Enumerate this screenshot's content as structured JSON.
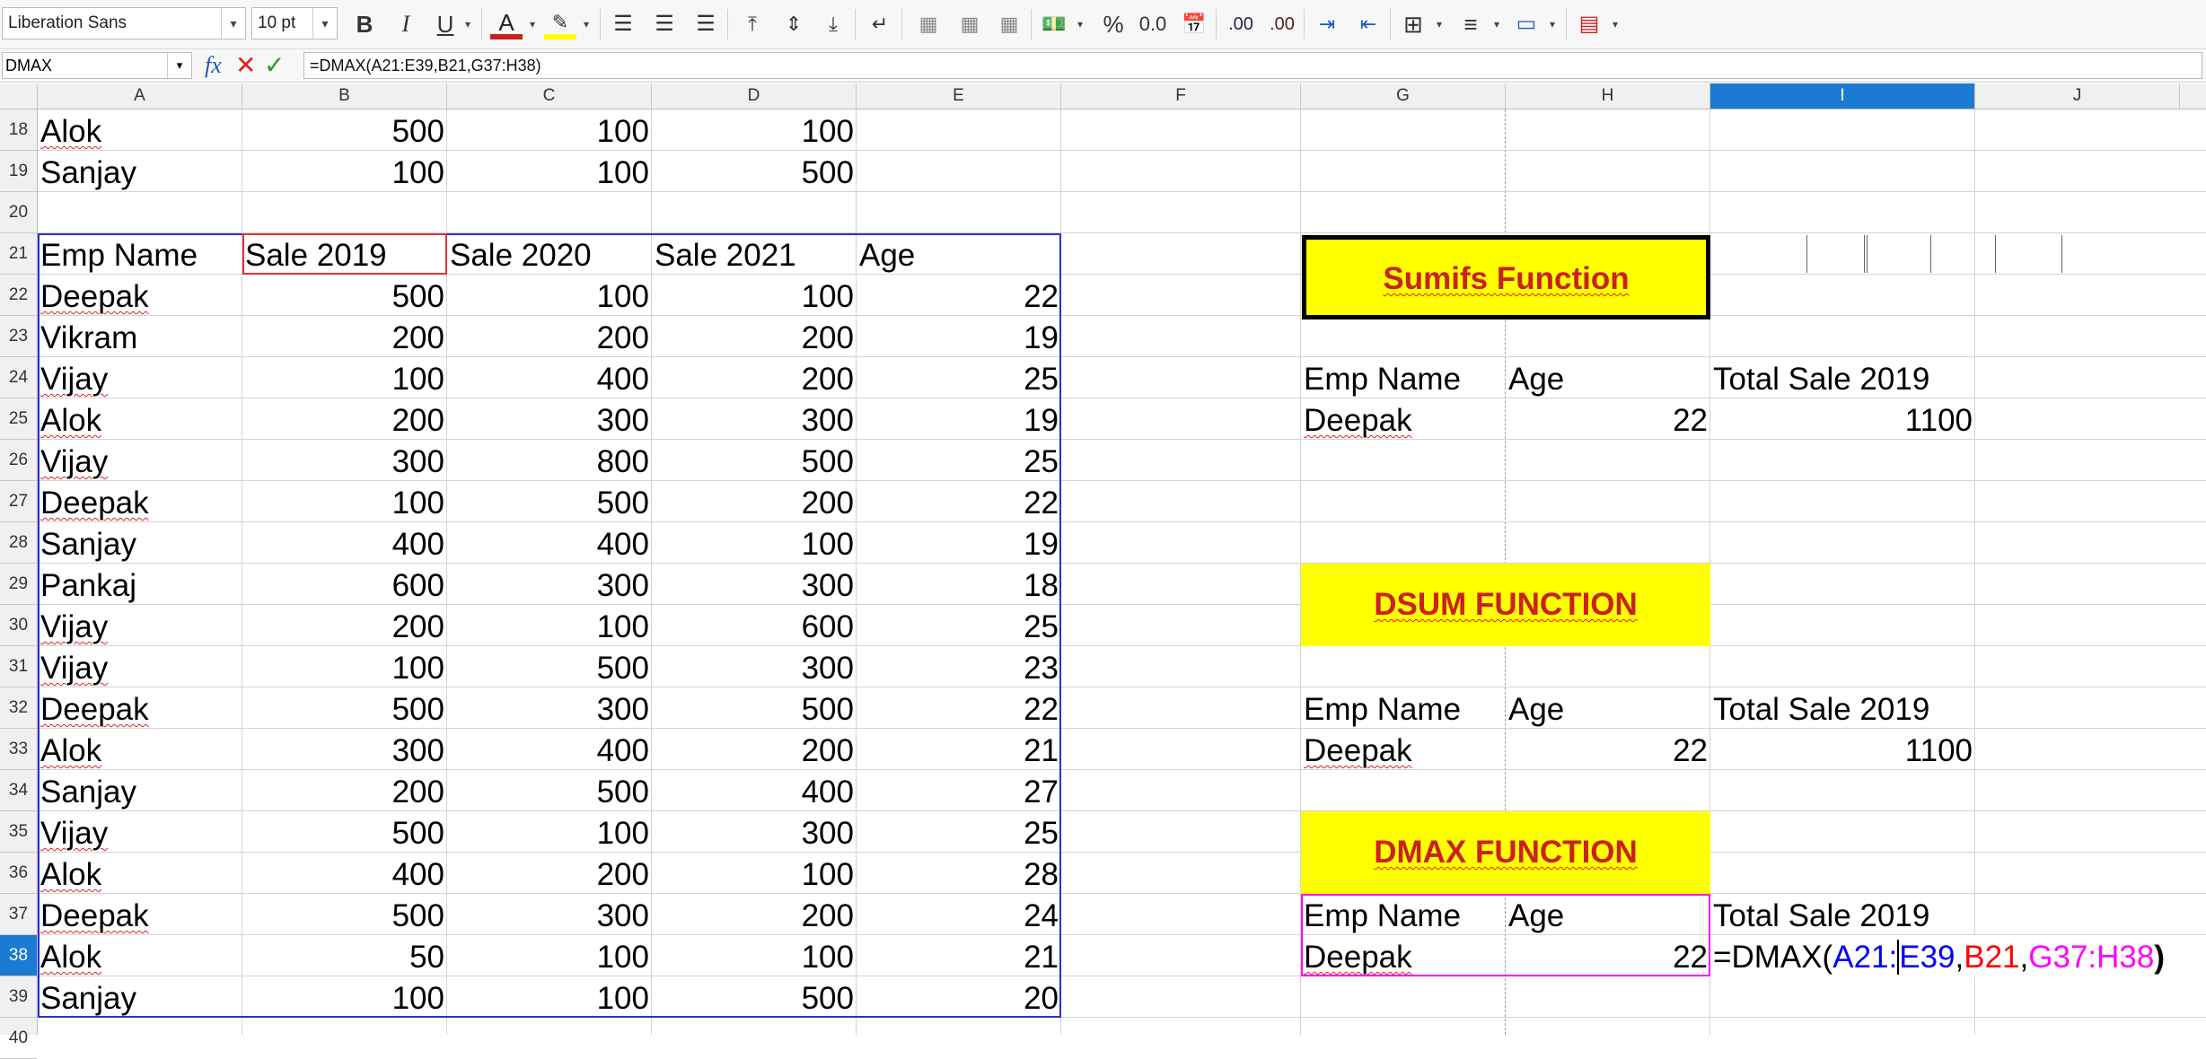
{
  "toolbar": {
    "font_name": "Liberation Sans",
    "font_size": "10 pt",
    "bold": "B",
    "italic": "I",
    "underline": "U",
    "font_color_label": "A",
    "percent": "%",
    "number_format": "0.0",
    "decimal_add": ".00",
    "decimal_remove": ".00"
  },
  "formula_bar": {
    "name_box": "DMAX",
    "fx": "fx",
    "formula": "=DMAX(A21:E39,B21,G37:H38)"
  },
  "columns": [
    "A",
    "B",
    "C",
    "D",
    "E",
    "F",
    "G",
    "H",
    "I",
    "J"
  ],
  "active_column": "I",
  "rows": [
    "18",
    "19",
    "20",
    "21",
    "22",
    "23",
    "24",
    "25",
    "26",
    "27",
    "28",
    "29",
    "30",
    "31",
    "32",
    "33",
    "34",
    "35",
    "36",
    "37",
    "38",
    "39",
    "40"
  ],
  "active_row": "38",
  "main_table": {
    "top_rows": [
      {
        "name": "Alok",
        "b": "500",
        "c": "100",
        "d": "100"
      },
      {
        "name": "Sanjay",
        "b": "100",
        "c": "100",
        "d": "500"
      }
    ],
    "headers": [
      "Emp Name",
      "Sale 2019",
      "Sale 2020",
      "Sale 2021",
      "Age"
    ],
    "rows": [
      {
        "name": "Deepak",
        "b": "500",
        "c": "100",
        "d": "100",
        "e": "22"
      },
      {
        "name": "Vikram",
        "b": "200",
        "c": "200",
        "d": "200",
        "e": "19"
      },
      {
        "name": "Vijay",
        "b": "100",
        "c": "400",
        "d": "200",
        "e": "25"
      },
      {
        "name": "Alok",
        "b": "200",
        "c": "300",
        "d": "300",
        "e": "19"
      },
      {
        "name": "Vijay",
        "b": "300",
        "c": "800",
        "d": "500",
        "e": "25"
      },
      {
        "name": "Deepak",
        "b": "100",
        "c": "500",
        "d": "200",
        "e": "22"
      },
      {
        "name": "Sanjay",
        "b": "400",
        "c": "400",
        "d": "100",
        "e": "19"
      },
      {
        "name": "Pankaj",
        "b": "600",
        "c": "300",
        "d": "300",
        "e": "18"
      },
      {
        "name": "Vijay",
        "b": "200",
        "c": "100",
        "d": "600",
        "e": "25"
      },
      {
        "name": "Vijay",
        "b": "100",
        "c": "500",
        "d": "300",
        "e": "23"
      },
      {
        "name": "Deepak",
        "b": "500",
        "c": "300",
        "d": "500",
        "e": "22"
      },
      {
        "name": "Alok",
        "b": "300",
        "c": "400",
        "d": "200",
        "e": "21"
      },
      {
        "name": "Sanjay",
        "b": "200",
        "c": "500",
        "d": "400",
        "e": "27"
      },
      {
        "name": "Vijay",
        "b": "500",
        "c": "100",
        "d": "300",
        "e": "25"
      },
      {
        "name": "Alok",
        "b": "400",
        "c": "200",
        "d": "100",
        "e": "28"
      },
      {
        "name": "Deepak",
        "b": "500",
        "c": "300",
        "d": "200",
        "e": "24"
      },
      {
        "name": "Alok",
        "b": "50",
        "c": "100",
        "d": "100",
        "e": "21"
      },
      {
        "name": "Sanjay",
        "b": "100",
        "c": "100",
        "d": "500",
        "e": "20"
      }
    ]
  },
  "sumifs": {
    "title": "Sumifs Function",
    "h1": "Emp Name",
    "h2": "Age",
    "h3": "Total Sale 2019",
    "v1": "Deepak",
    "v2": "22",
    "v3": "1100"
  },
  "dsum": {
    "title": "DSUM FUNCTION",
    "h1": "Emp Name",
    "h2": "Age",
    "h3": "Total Sale 2019",
    "v1": "Deepak",
    "v2": "22",
    "v3": "1100"
  },
  "dmax": {
    "title": "DMAX FUNCTION",
    "h1": "Emp Name",
    "h2": "Age",
    "h3": "Total Sale 2019",
    "v1": "Deepak",
    "v2": "22",
    "edit_prefix": "=DMAX(",
    "ref1a": "A21:",
    "ref1b": "E39",
    "comma1": ",",
    "ref2": "B21",
    "comma2": ",",
    "ref3": "G37:H38",
    "close": ")"
  },
  "colors": {
    "banner_bg": "#ffff00",
    "banner_text": "#c9211e",
    "ref_blue": "#0000ff",
    "ref_red": "#ff0000",
    "ref_magenta": "#ff00ff",
    "selection": "#1b7ad1"
  }
}
